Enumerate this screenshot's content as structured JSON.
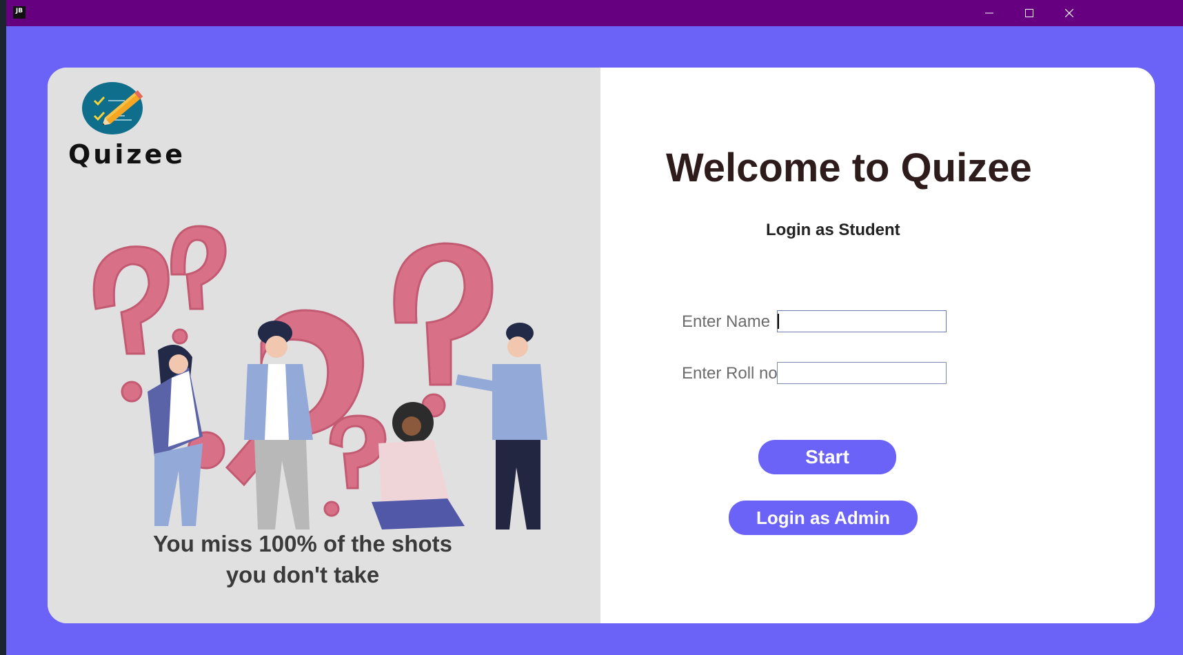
{
  "titlebar": {
    "app_icon_text": "JB",
    "minimize_symbol": "—",
    "maximize_symbol": "☐",
    "close_symbol": "✕"
  },
  "brand": {
    "logo_text": "Quizee",
    "logo_icon": "checklist-pencil-icon"
  },
  "illustration": {
    "quote_line1": "You miss 100% of the shots",
    "quote_line2": "you don't take"
  },
  "login": {
    "welcome": "Welcome to Quizee",
    "subtitle": "Login as Student",
    "name_label": "Enter Name",
    "name_value": "",
    "roll_label": "Enter Roll no",
    "roll_value": "",
    "start_button": "Start",
    "admin_button": "Login as Admin"
  },
  "colors": {
    "titlebar": "#660080",
    "background": "#6b63f7",
    "accent": "#6b63f7",
    "left_panel": "#e1e0e1",
    "question_mark": "#d87088"
  }
}
